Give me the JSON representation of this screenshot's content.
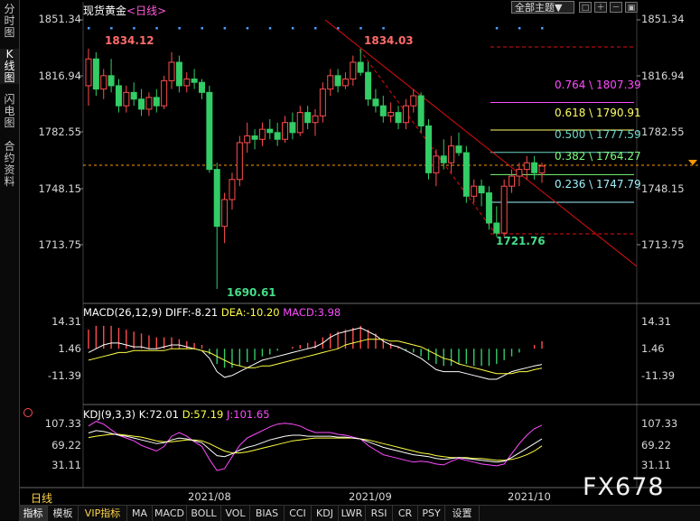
{
  "app": {
    "title": "现货黄金",
    "period_tag": "<日线>",
    "period_label": "日线",
    "theme_button": "全部主题▼",
    "watermark": "FX678"
  },
  "sidebar": {
    "tabs": [
      {
        "label": "分时图",
        "active": false
      },
      {
        "label": "K线图",
        "active": true
      },
      {
        "label": "闪电图",
        "active": false
      },
      {
        "label": "合约资料",
        "active": false
      }
    ]
  },
  "price_axis": {
    "labels": [
      "1851.34",
      "1816.94",
      "1782.55",
      "1748.15",
      "1713.75"
    ]
  },
  "macd_axis": {
    "labels": [
      "14.31",
      "1.46",
      "-11.39"
    ]
  },
  "kdj_axis": {
    "labels": [
      "107.33",
      "69.22",
      "31.11"
    ]
  },
  "x_axis": {
    "labels": [
      "2021/08",
      "2021/09",
      "2021/10"
    ]
  },
  "annotations": {
    "high_left": "1834.12",
    "high_right": "1834.03",
    "low_main": "1690.61",
    "low_recent": "1721.76"
  },
  "fibonacci": [
    {
      "label": "0.764 \\ 1807.39",
      "color": "#ff4cff"
    },
    {
      "label": "0.618 \\ 1790.91",
      "color": "#ffff66"
    },
    {
      "label": "0.500 \\ 1777.59",
      "color": "#6fd6c8"
    },
    {
      "label": "0.382 \\ 1764.27",
      "color": "#7dff7d"
    },
    {
      "label": "0.236 \\ 1747.79",
      "color": "#9ff2ff"
    }
  ],
  "indicators": {
    "macd": {
      "name": "MACD(26,12,9)",
      "diff": "DIFF:-8.21",
      "dea": "DEA:-10.20",
      "macd": "MACD:3.98"
    },
    "kdj": {
      "name": "KDJ(9,3,3)",
      "k": "K:72.01",
      "d": "D:57.19",
      "j": "J:101.65"
    }
  },
  "bottom_tabs": [
    {
      "label": "指标",
      "active": true,
      "vip": false
    },
    {
      "label": "模板",
      "active": false,
      "vip": false
    },
    {
      "label": "VIP指标",
      "active": false,
      "vip": true
    },
    {
      "label": "MA",
      "active": false,
      "vip": false
    },
    {
      "label": "MACD",
      "active": false,
      "vip": false
    },
    {
      "label": "BOLL",
      "active": false,
      "vip": false
    },
    {
      "label": "VOL",
      "active": false,
      "vip": false
    },
    {
      "label": "BIAS",
      "active": false,
      "vip": false
    },
    {
      "label": "CCI",
      "active": false,
      "vip": false
    },
    {
      "label": "KDJ",
      "active": false,
      "vip": false
    },
    {
      "label": "LWR",
      "active": false,
      "vip": false
    },
    {
      "label": "RSI",
      "active": false,
      "vip": false
    },
    {
      "label": "CR",
      "active": false,
      "vip": false
    },
    {
      "label": "PSY",
      "active": false,
      "vip": false
    },
    {
      "label": "设置",
      "active": false,
      "vip": false
    }
  ],
  "colors": {
    "up": "#ff4d4d",
    "down": "#33cc66",
    "trendline": "#e01010",
    "dotted_marker": "#4aa0ff",
    "current_price": "#ff9900"
  },
  "chart_data": {
    "type": "candlestick",
    "symbol": "现货黄金",
    "y_range": [
      1690.61,
      1851.34
    ],
    "candles": [
      {
        "o": 1812,
        "h": 1834.12,
        "l": 1800,
        "c": 1828
      },
      {
        "o": 1828,
        "h": 1832,
        "l": 1806,
        "c": 1810
      },
      {
        "o": 1810,
        "h": 1822,
        "l": 1804,
        "c": 1818
      },
      {
        "o": 1818,
        "h": 1828,
        "l": 1808,
        "c": 1812
      },
      {
        "o": 1812,
        "h": 1816,
        "l": 1796,
        "c": 1800
      },
      {
        "o": 1800,
        "h": 1812,
        "l": 1796,
        "c": 1808
      },
      {
        "o": 1808,
        "h": 1814,
        "l": 1800,
        "c": 1804
      },
      {
        "o": 1804,
        "h": 1810,
        "l": 1794,
        "c": 1798
      },
      {
        "o": 1798,
        "h": 1808,
        "l": 1794,
        "c": 1805
      },
      {
        "o": 1805,
        "h": 1810,
        "l": 1796,
        "c": 1800
      },
      {
        "o": 1800,
        "h": 1818,
        "l": 1798,
        "c": 1815
      },
      {
        "o": 1815,
        "h": 1832,
        "l": 1810,
        "c": 1826
      },
      {
        "o": 1826,
        "h": 1830,
        "l": 1808,
        "c": 1812
      },
      {
        "o": 1812,
        "h": 1820,
        "l": 1808,
        "c": 1816
      },
      {
        "o": 1816,
        "h": 1822,
        "l": 1810,
        "c": 1814
      },
      {
        "o": 1814,
        "h": 1816,
        "l": 1804,
        "c": 1808
      },
      {
        "o": 1808,
        "h": 1812,
        "l": 1760,
        "c": 1762
      },
      {
        "o": 1762,
        "h": 1766,
        "l": 1690.61,
        "c": 1728
      },
      {
        "o": 1728,
        "h": 1748,
        "l": 1718,
        "c": 1744
      },
      {
        "o": 1744,
        "h": 1760,
        "l": 1738,
        "c": 1756
      },
      {
        "o": 1756,
        "h": 1782,
        "l": 1752,
        "c": 1778
      },
      {
        "o": 1778,
        "h": 1790,
        "l": 1772,
        "c": 1782
      },
      {
        "o": 1782,
        "h": 1786,
        "l": 1774,
        "c": 1780
      },
      {
        "o": 1780,
        "h": 1790,
        "l": 1776,
        "c": 1786
      },
      {
        "o": 1786,
        "h": 1792,
        "l": 1780,
        "c": 1784
      },
      {
        "o": 1784,
        "h": 1790,
        "l": 1776,
        "c": 1780
      },
      {
        "o": 1780,
        "h": 1794,
        "l": 1778,
        "c": 1790
      },
      {
        "o": 1790,
        "h": 1796,
        "l": 1780,
        "c": 1784
      },
      {
        "o": 1784,
        "h": 1800,
        "l": 1782,
        "c": 1796
      },
      {
        "o": 1796,
        "h": 1800,
        "l": 1786,
        "c": 1790
      },
      {
        "o": 1790,
        "h": 1798,
        "l": 1782,
        "c": 1794
      },
      {
        "o": 1794,
        "h": 1814,
        "l": 1790,
        "c": 1810
      },
      {
        "o": 1810,
        "h": 1822,
        "l": 1806,
        "c": 1818
      },
      {
        "o": 1818,
        "h": 1822,
        "l": 1808,
        "c": 1812
      },
      {
        "o": 1812,
        "h": 1820,
        "l": 1810,
        "c": 1816
      },
      {
        "o": 1816,
        "h": 1830,
        "l": 1812,
        "c": 1826
      },
      {
        "o": 1826,
        "h": 1834.03,
        "l": 1818,
        "c": 1820
      },
      {
        "o": 1820,
        "h": 1826,
        "l": 1800,
        "c": 1804
      },
      {
        "o": 1804,
        "h": 1810,
        "l": 1796,
        "c": 1800
      },
      {
        "o": 1800,
        "h": 1806,
        "l": 1790,
        "c": 1794
      },
      {
        "o": 1794,
        "h": 1802,
        "l": 1790,
        "c": 1796
      },
      {
        "o": 1796,
        "h": 1800,
        "l": 1786,
        "c": 1790
      },
      {
        "o": 1790,
        "h": 1804,
        "l": 1786,
        "c": 1800
      },
      {
        "o": 1800,
        "h": 1810,
        "l": 1796,
        "c": 1806
      },
      {
        "o": 1806,
        "h": 1808,
        "l": 1784,
        "c": 1788
      },
      {
        "o": 1788,
        "h": 1792,
        "l": 1756,
        "c": 1760
      },
      {
        "o": 1760,
        "h": 1774,
        "l": 1752,
        "c": 1770
      },
      {
        "o": 1770,
        "h": 1780,
        "l": 1762,
        "c": 1766
      },
      {
        "o": 1766,
        "h": 1782,
        "l": 1760,
        "c": 1776
      },
      {
        "o": 1776,
        "h": 1784,
        "l": 1770,
        "c": 1772
      },
      {
        "o": 1772,
        "h": 1776,
        "l": 1742,
        "c": 1746
      },
      {
        "o": 1746,
        "h": 1756,
        "l": 1742,
        "c": 1752
      },
      {
        "o": 1752,
        "h": 1756,
        "l": 1740,
        "c": 1748
      },
      {
        "o": 1748,
        "h": 1752,
        "l": 1726,
        "c": 1730
      },
      {
        "o": 1730,
        "h": 1740,
        "l": 1721.76,
        "c": 1724
      },
      {
        "o": 1724,
        "h": 1756,
        "l": 1722,
        "c": 1752
      },
      {
        "o": 1752,
        "h": 1762,
        "l": 1748,
        "c": 1758
      },
      {
        "o": 1758,
        "h": 1766,
        "l": 1752,
        "c": 1762
      },
      {
        "o": 1762,
        "h": 1770,
        "l": 1756,
        "c": 1766
      },
      {
        "o": 1766,
        "h": 1770,
        "l": 1756,
        "c": 1760
      },
      {
        "o": 1760,
        "h": 1766,
        "l": 1754,
        "c": 1764
      }
    ],
    "macd": {
      "hist": [
        10,
        12,
        12,
        12,
        11,
        10,
        9,
        8,
        7,
        6,
        6,
        6,
        5,
        4,
        3,
        2,
        -3,
        -8,
        -10,
        -10,
        -9,
        -7,
        -6,
        -4,
        -3,
        -1,
        0,
        1,
        2,
        3,
        4,
        6,
        8,
        9,
        10,
        11,
        12,
        10,
        8,
        5,
        3,
        1,
        -1,
        -2,
        -4,
        -6,
        -8,
        -9,
        -9,
        -8,
        -8,
        -9,
        -9,
        -9,
        -8,
        -6,
        -4,
        -2,
        0,
        2,
        3.98
      ],
      "diff": [
        -2,
        0,
        2,
        3,
        3,
        2,
        1,
        1,
        0,
        0,
        1,
        2,
        2,
        1,
        0,
        -1,
        -5,
        -12,
        -15,
        -14,
        -12,
        -10,
        -8,
        -6,
        -5,
        -4,
        -3,
        -2,
        -1,
        0,
        1,
        3,
        6,
        8,
        9,
        10,
        11,
        9,
        7,
        4,
        2,
        1,
        -1,
        -3,
        -5,
        -8,
        -11,
        -12,
        -12,
        -12,
        -13,
        -14,
        -15,
        -16,
        -16,
        -14,
        -12,
        -11,
        -10,
        -9,
        -8.21
      ],
      "dea": [
        -6,
        -5,
        -4,
        -3,
        -2,
        -2,
        -1,
        -1,
        -1,
        -1,
        -1,
        0,
        0,
        0,
        0,
        -1,
        -2,
        -4,
        -6,
        -8,
        -9,
        -10,
        -10,
        -9,
        -9,
        -8,
        -7,
        -6,
        -5,
        -4,
        -3,
        -2,
        -1,
        0,
        2,
        3,
        4,
        5,
        5,
        5,
        4,
        4,
        3,
        2,
        1,
        -1,
        -3,
        -5,
        -6,
        -8,
        -9,
        -10,
        -11,
        -12,
        -13,
        -13,
        -13,
        -12,
        -12,
        -11,
        -10.2
      ]
    },
    "kdj": {
      "k": [
        85,
        90,
        88,
        84,
        80,
        78,
        74,
        70,
        66,
        62,
        64,
        70,
        74,
        72,
        68,
        64,
        50,
        36,
        34,
        40,
        48,
        54,
        58,
        64,
        70,
        74,
        78,
        80,
        80,
        78,
        78,
        78,
        78,
        76,
        76,
        74,
        72,
        66,
        60,
        54,
        50,
        46,
        42,
        38,
        36,
        34,
        30,
        28,
        30,
        32,
        30,
        28,
        26,
        24,
        22,
        24,
        32,
        42,
        52,
        62,
        72.01
      ],
      "d": [
        75,
        78,
        80,
        82,
        82,
        80,
        78,
        76,
        72,
        68,
        66,
        66,
        68,
        70,
        70,
        68,
        62,
        54,
        46,
        42,
        42,
        44,
        48,
        52,
        56,
        60,
        64,
        68,
        70,
        72,
        74,
        74,
        74,
        74,
        74,
        74,
        72,
        70,
        66,
        62,
        58,
        54,
        50,
        46,
        42,
        40,
        36,
        34,
        32,
        32,
        32,
        30,
        30,
        28,
        26,
        26,
        28,
        32,
        38,
        46,
        57.19
      ],
      "j": [
        100,
        110,
        104,
        92,
        80,
        74,
        68,
        58,
        52,
        46,
        56,
        78,
        86,
        78,
        66,
        56,
        28,
        4,
        8,
        34,
        58,
        74,
        82,
        90,
        98,
        104,
        106,
        104,
        100,
        92,
        86,
        86,
        86,
        82,
        80,
        76,
        72,
        58,
        48,
        38,
        34,
        30,
        26,
        22,
        24,
        22,
        18,
        16,
        24,
        30,
        26,
        22,
        18,
        16,
        14,
        18,
        40,
        62,
        80,
        94,
        101.65
      ]
    }
  }
}
